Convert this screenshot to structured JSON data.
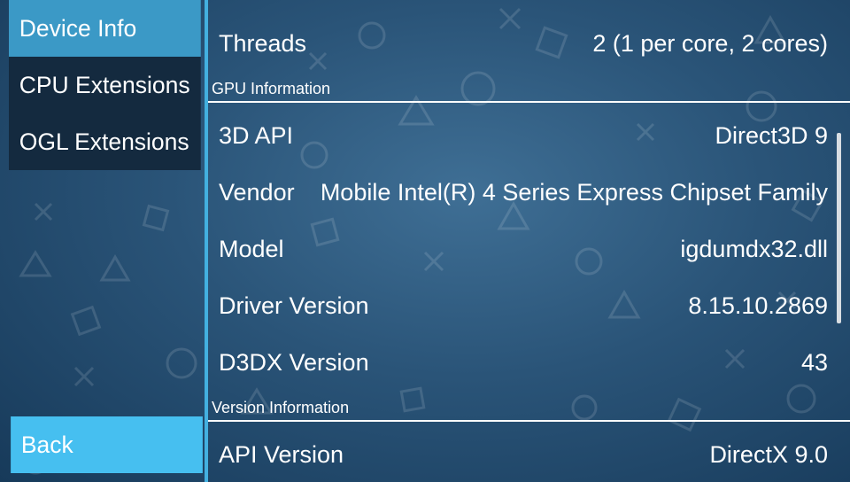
{
  "sidebar": {
    "tabs": [
      {
        "label": "Device Info",
        "active": true
      },
      {
        "label": "CPU Extensions",
        "active": false
      },
      {
        "label": "OGL Extensions",
        "active": false
      }
    ],
    "back_label": "Back"
  },
  "content": {
    "rows_top": [
      {
        "label": "Threads",
        "value": "2 (1 per core, 2 cores)"
      }
    ],
    "gpu_section": {
      "title": "GPU Information",
      "rows": [
        {
          "label": "3D API",
          "value": "Direct3D 9"
        },
        {
          "label": "Vendor",
          "value": "Mobile Intel(R) 4 Series Express Chipset Family"
        },
        {
          "label": "Model",
          "value": "igdumdx32.dll"
        },
        {
          "label": "Driver Version",
          "value": "8.15.10.2869"
        },
        {
          "label": "D3DX Version",
          "value": "43"
        }
      ]
    },
    "version_section": {
      "title": "Version Information",
      "rows": [
        {
          "label": "API Version",
          "value": "DirectX 9.0"
        }
      ]
    }
  },
  "colors": {
    "active_tab": "#3b99c6",
    "inactive_tab": "#142a3f",
    "back_button": "#46bff0",
    "accent_line": "#43b0e0",
    "bg_dark": "#173a5a",
    "bg_light": "#3f6f95"
  },
  "icons": [
    "circle-icon",
    "cross-icon",
    "square-icon",
    "triangle-icon"
  ]
}
